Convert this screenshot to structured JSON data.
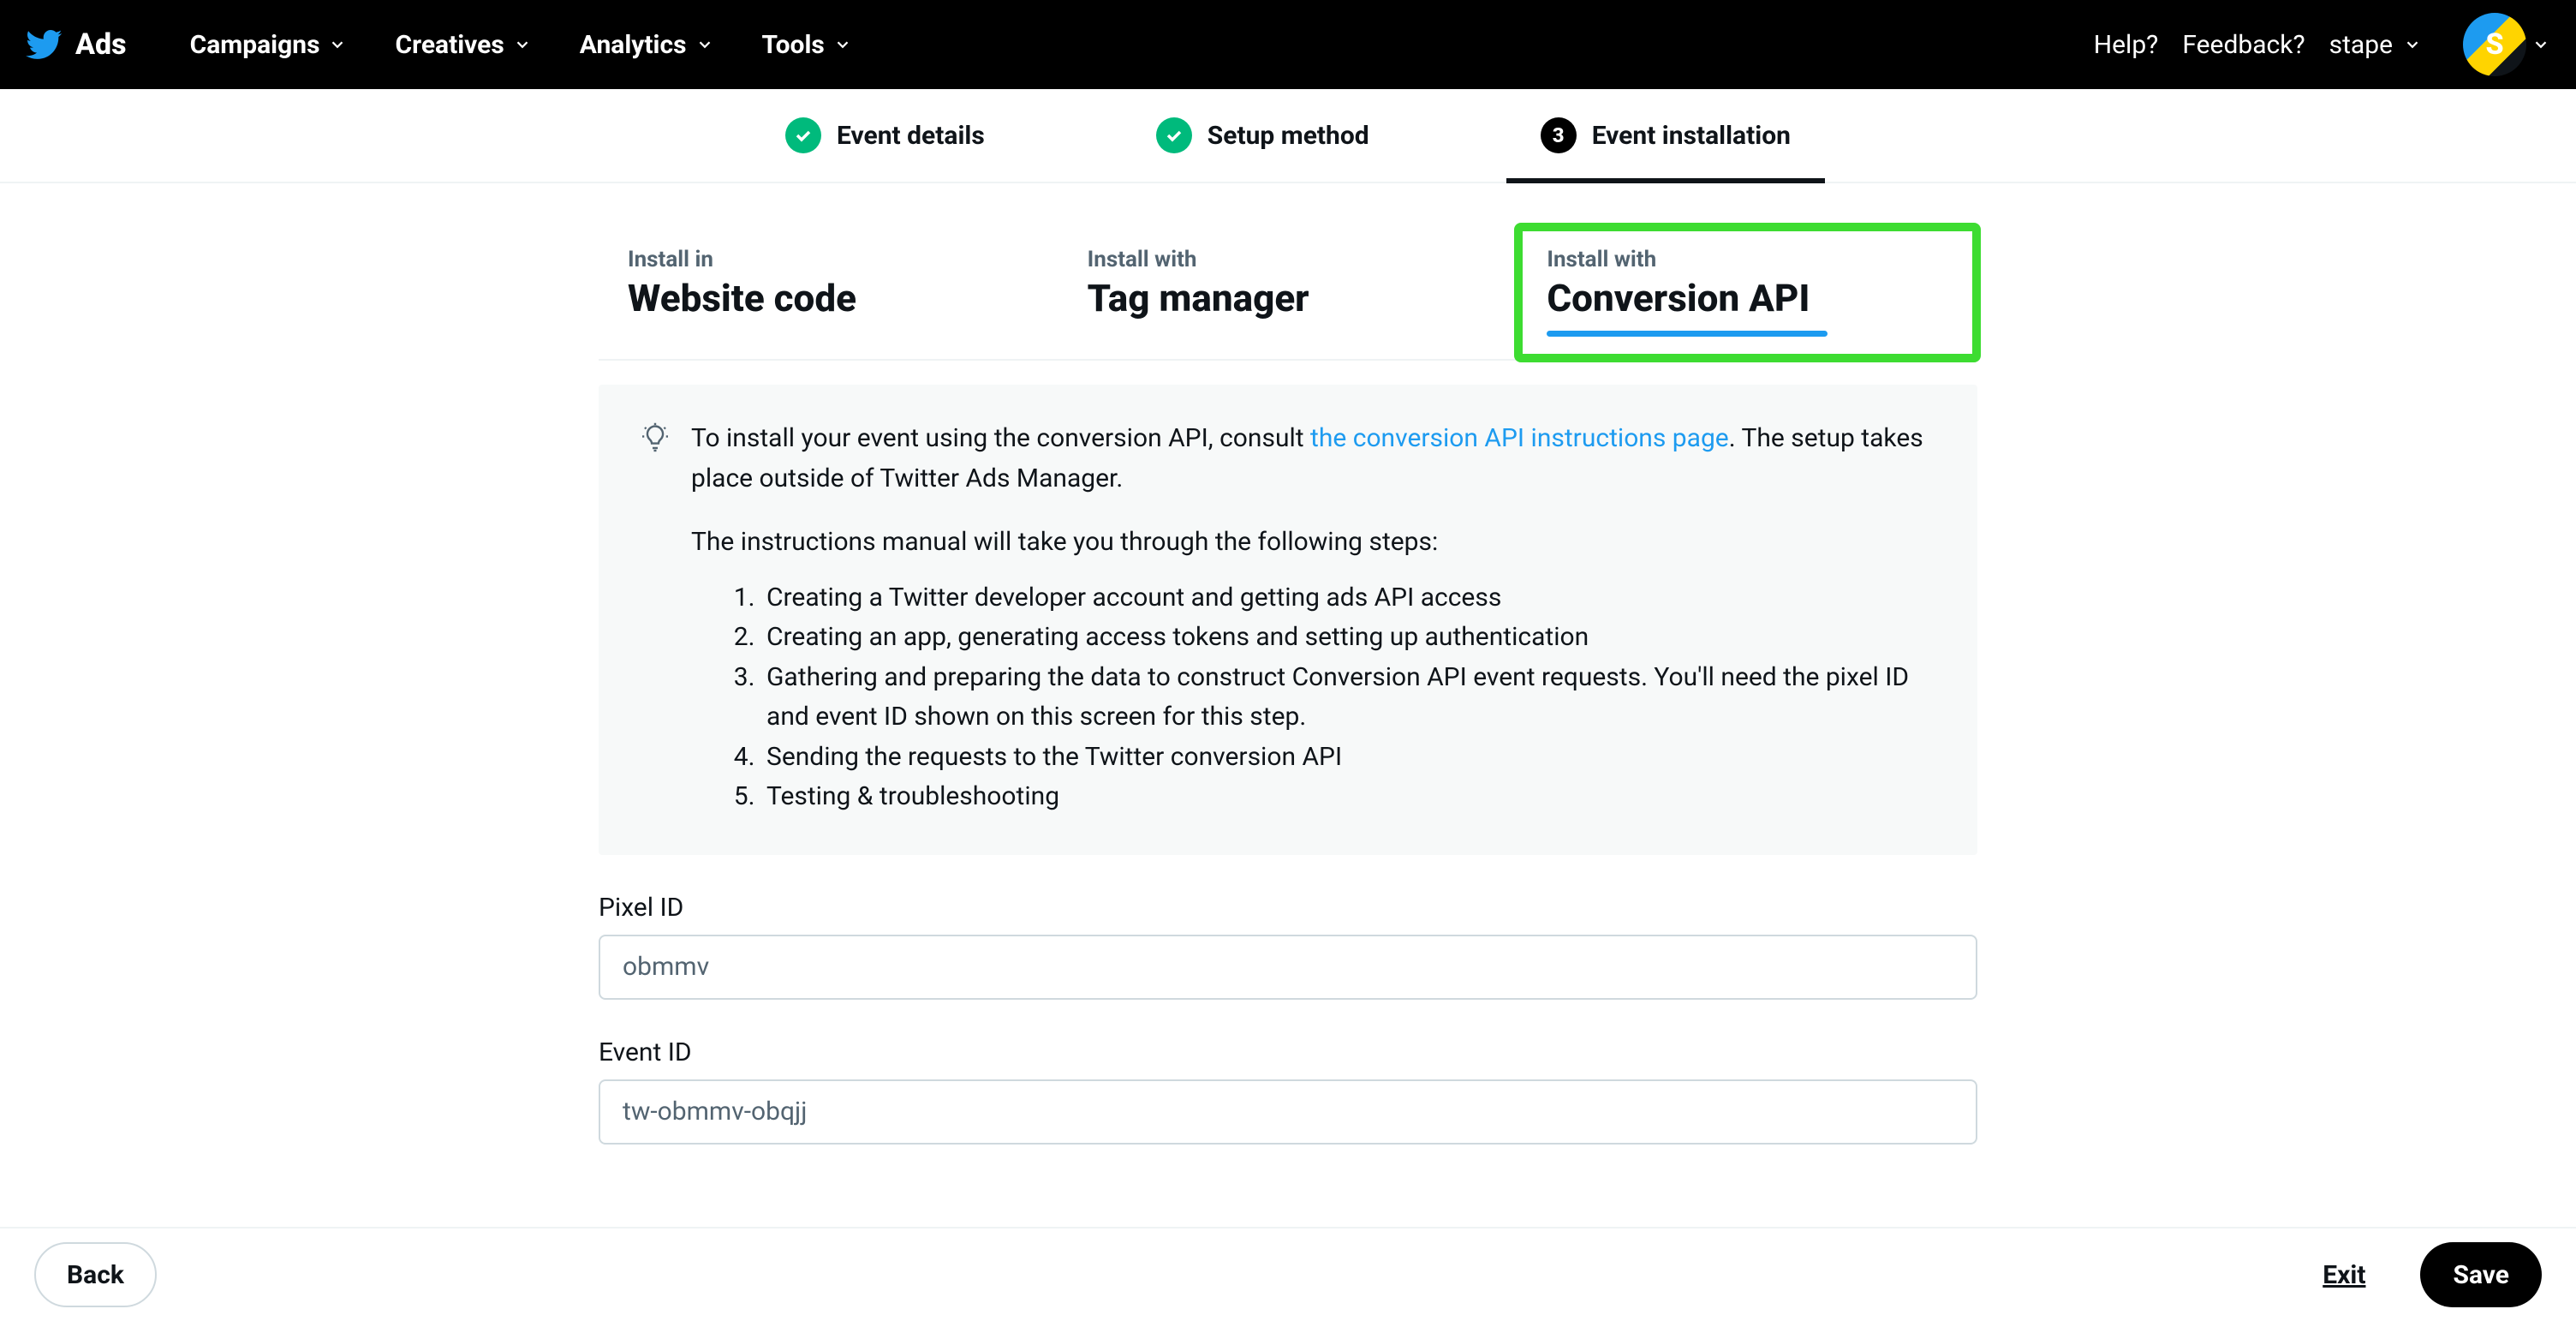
{
  "nav": {
    "brand": "Ads",
    "items": [
      "Campaigns",
      "Creatives",
      "Analytics",
      "Tools"
    ],
    "help": "Help?",
    "feedback": "Feedback?",
    "account": "stape",
    "avatar_letter": "S"
  },
  "steps": {
    "s1": "Event details",
    "s2": "Setup method",
    "s3": "Event installation",
    "s3_num": "3"
  },
  "tabs": {
    "t1_top": "Install in",
    "t1_title": "Website code",
    "t2_top": "Install with",
    "t2_title": "Tag manager",
    "t3_top": "Install with",
    "t3_title": "Conversion API"
  },
  "info": {
    "lead_pre": "To install your event using the conversion API, consult ",
    "link": "the conversion API instructions page",
    "lead_post": ". The setup takes place outside of Twitter Ads Manager.",
    "sub": "The instructions manual will take you through the following steps:",
    "steps": [
      "Creating a Twitter developer account and getting ads API access",
      "Creating an app, generating access tokens and setting up authentication",
      "Gathering and preparing the data to construct Conversion API event requests. You'll need the pixel ID and event ID shown on this screen for this step.",
      "Sending the requests to the Twitter conversion API",
      "Testing & troubleshooting"
    ]
  },
  "fields": {
    "pixel_label": "Pixel ID",
    "pixel_value": "obmmv",
    "event_label": "Event ID",
    "event_value": "tw-obmmv-obqjj"
  },
  "footer": {
    "back": "Back",
    "exit": "Exit",
    "save": "Save"
  }
}
